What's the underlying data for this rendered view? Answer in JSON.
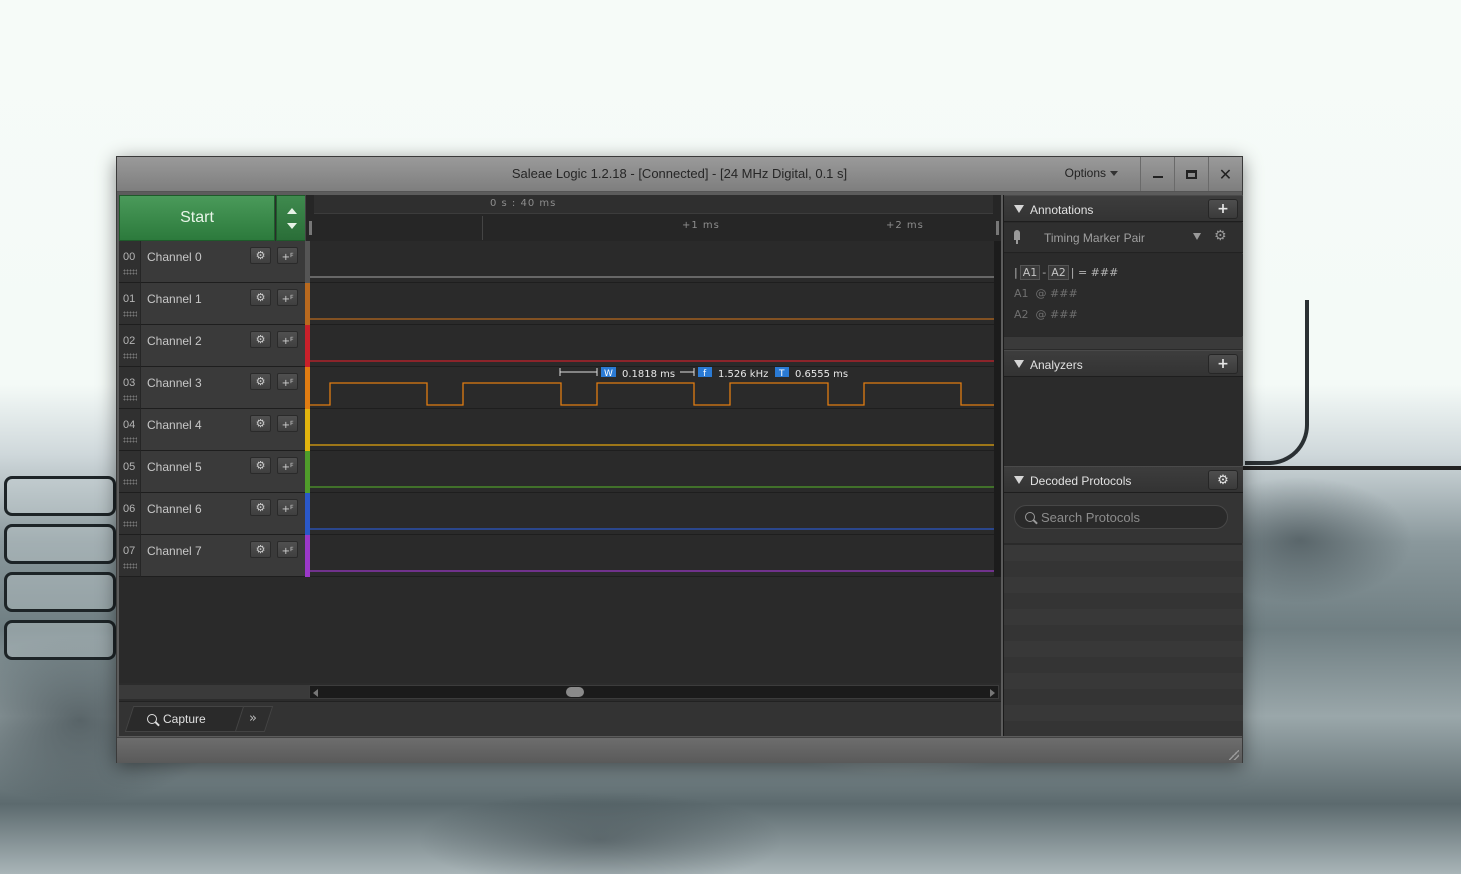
{
  "window": {
    "title": "Saleae Logic 1.2.18 - [Connected] - [24 MHz Digital, 0.1 s]",
    "options_label": "Options"
  },
  "toolbar": {
    "start_label": "Start"
  },
  "ruler": {
    "time_label": "0 s : 40 ms",
    "tick_labels": [
      "+1 ms",
      "+2 ms"
    ]
  },
  "channels": [
    {
      "num": "00",
      "name": "Channel 0",
      "color": "#9a9a9a"
    },
    {
      "num": "01",
      "name": "Channel 1",
      "color": "#b8691e"
    },
    {
      "num": "02",
      "name": "Channel 2",
      "color": "#c8202a"
    },
    {
      "num": "03",
      "name": "Channel 3",
      "color": "#e07c12"
    },
    {
      "num": "04",
      "name": "Channel 4",
      "color": "#e2b40e"
    },
    {
      "num": "05",
      "name": "Channel 5",
      "color": "#4f9c2a"
    },
    {
      "num": "06",
      "name": "Channel 6",
      "color": "#2a58c8"
    },
    {
      "num": "07",
      "name": "Channel 7",
      "color": "#9a38c8"
    }
  ],
  "measurement": {
    "width_badge": "W",
    "width_value": "0.1818 ms",
    "freq_badge": "f",
    "freq_value": "1.526 kHz",
    "period_badge": "T",
    "period_value": "0.6555 ms"
  },
  "bottom_tabs": {
    "capture_label": "Capture",
    "more_label": "»"
  },
  "annotations": {
    "title": "Annotations",
    "add_label": "+",
    "marker_type": "Timing Marker Pair",
    "line1_a1": "A1",
    "line1_a2": "A2",
    "line1_value": "| = ###",
    "line2_label": "A1",
    "line2_value": "@  ###",
    "line3_label": "A2",
    "line3_value": "@  ###"
  },
  "analyzers": {
    "title": "Analyzers",
    "add_label": "+"
  },
  "decoded_protocols": {
    "title": "Decoded Protocols",
    "search_placeholder": "Search Protocols"
  },
  "colors": {
    "start_green": "#2c7a3c",
    "channel3_signal": "#e07c12"
  }
}
